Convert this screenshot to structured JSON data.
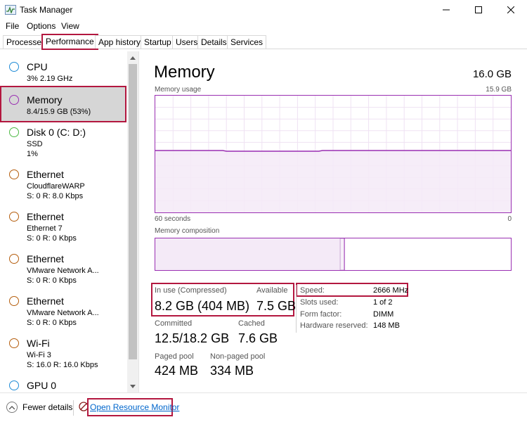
{
  "window": {
    "title": "Task Manager",
    "icon": "task-manager-icon"
  },
  "menu": [
    "File",
    "Options",
    "View"
  ],
  "tabs": [
    {
      "label": "Processes",
      "active": false
    },
    {
      "label": "Performance",
      "active": true
    },
    {
      "label": "App history",
      "active": false
    },
    {
      "label": "Startup",
      "active": false
    },
    {
      "label": "Users",
      "active": false
    },
    {
      "label": "Details",
      "active": false
    },
    {
      "label": "Services",
      "active": false
    }
  ],
  "sidebar": {
    "items": [
      {
        "name": "CPU",
        "sub1": "3%  2.19 GHz",
        "sub2": "",
        "color": "#1f8bd6"
      },
      {
        "name": "Memory",
        "sub1": "8.4/15.9 GB (53%)",
        "sub2": "",
        "color": "#9a2fb2",
        "selected": true
      },
      {
        "name": "Disk 0 (C: D:)",
        "sub1": "SSD",
        "sub2": "1%",
        "color": "#4cb944"
      },
      {
        "name": "Ethernet",
        "sub1": "CloudflareWARP",
        "sub2": "S: 0  R: 8.0 Kbps",
        "color": "#b55e0e"
      },
      {
        "name": "Ethernet",
        "sub1": "Ethernet 7",
        "sub2": "S: 0  R: 0 Kbps",
        "color": "#b55e0e"
      },
      {
        "name": "Ethernet",
        "sub1": "VMware Network A...",
        "sub2": "S: 0  R: 0 Kbps",
        "color": "#b55e0e"
      },
      {
        "name": "Ethernet",
        "sub1": "VMware Network A...",
        "sub2": "S: 0  R: 0 Kbps",
        "color": "#b55e0e"
      },
      {
        "name": "Wi-Fi",
        "sub1": "Wi-Fi 3",
        "sub2": "S: 16.0  R: 16.0 Kbps",
        "color": "#b55e0e"
      },
      {
        "name": "GPU 0",
        "sub1": "",
        "sub2": "",
        "color": "#1f8bd6"
      }
    ]
  },
  "memory": {
    "title": "Memory",
    "total": "16.0 GB",
    "usage_label": "Memory usage",
    "usage_max": "15.9 GB",
    "time_left": "60 seconds",
    "time_right": "0",
    "composition_label": "Memory composition",
    "usage_level": 0.53,
    "composition_in_use_fraction": 0.52,
    "stats": {
      "in_use_label": "In use (Compressed)",
      "in_use_value": "8.2 GB (404 MB)",
      "available_label": "Available",
      "available_value": "7.5 GB",
      "committed_label": "Committed",
      "committed_value": "12.5/18.2 GB",
      "cached_label": "Cached",
      "cached_value": "7.6 GB",
      "paged_label": "Paged pool",
      "paged_value": "424 MB",
      "nonpaged_label": "Non-paged pool",
      "nonpaged_value": "334 MB"
    },
    "details": {
      "speed_label": "Speed:",
      "speed_value": "2666 MHz",
      "slots_label": "Slots used:",
      "slots_value": "1 of 2",
      "form_label": "Form factor:",
      "form_value": "DIMM",
      "hwres_label": "Hardware reserved:",
      "hwres_value": "148 MB"
    }
  },
  "footer": {
    "fewer_details": "Fewer details",
    "resource_monitor": "Open Resource Monitor"
  },
  "colors": {
    "accent": "#b3173f",
    "memory": "#9a2fb2",
    "memory_fill": "#f4eaf7"
  }
}
